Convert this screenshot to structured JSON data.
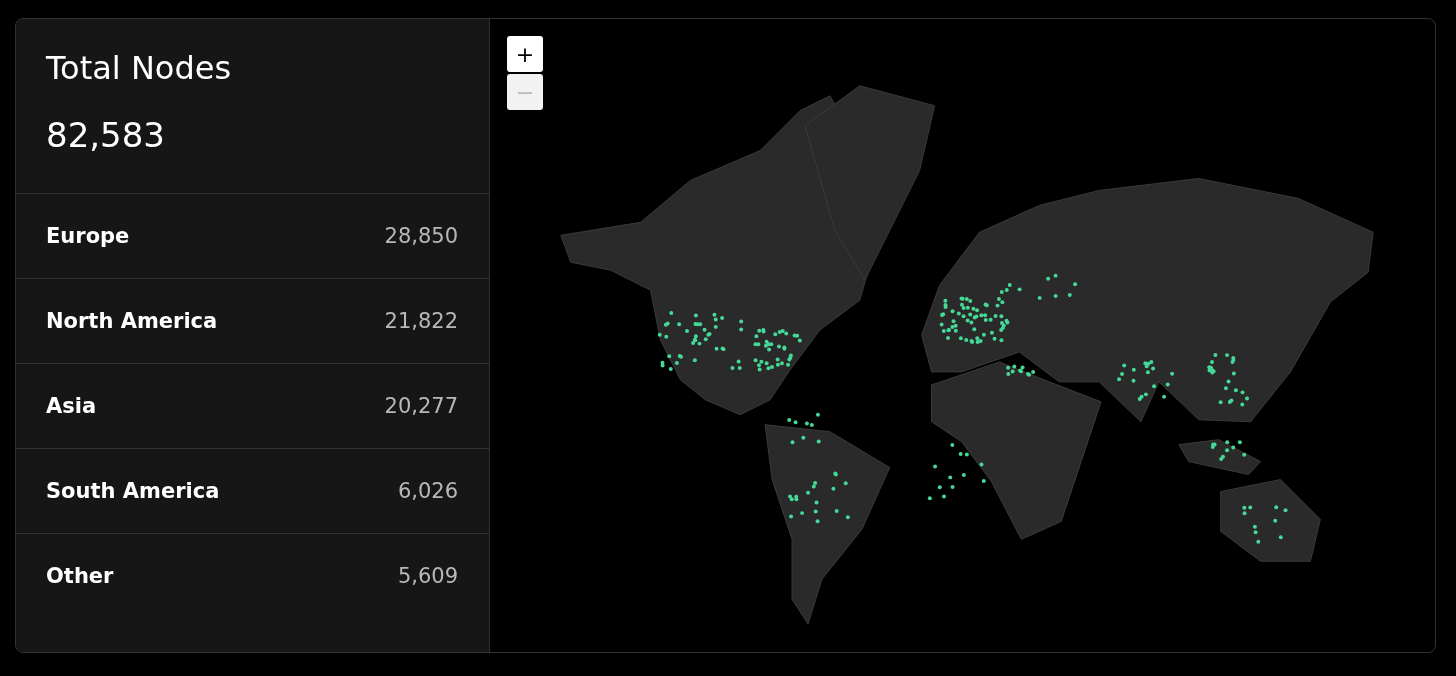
{
  "summary": {
    "title": "Total Nodes",
    "total": "82,583"
  },
  "regions": [
    {
      "name": "Europe",
      "count": "28,850"
    },
    {
      "name": "North America",
      "count": "21,822"
    },
    {
      "name": "Asia",
      "count": "20,277"
    },
    {
      "name": "South America",
      "count": "6,026"
    },
    {
      "name": "Other",
      "count": "5,609"
    }
  ],
  "map": {
    "zoom_controls": [
      {
        "label": "+",
        "disabled": false
      },
      {
        "label": "−",
        "disabled": true
      }
    ]
  }
}
